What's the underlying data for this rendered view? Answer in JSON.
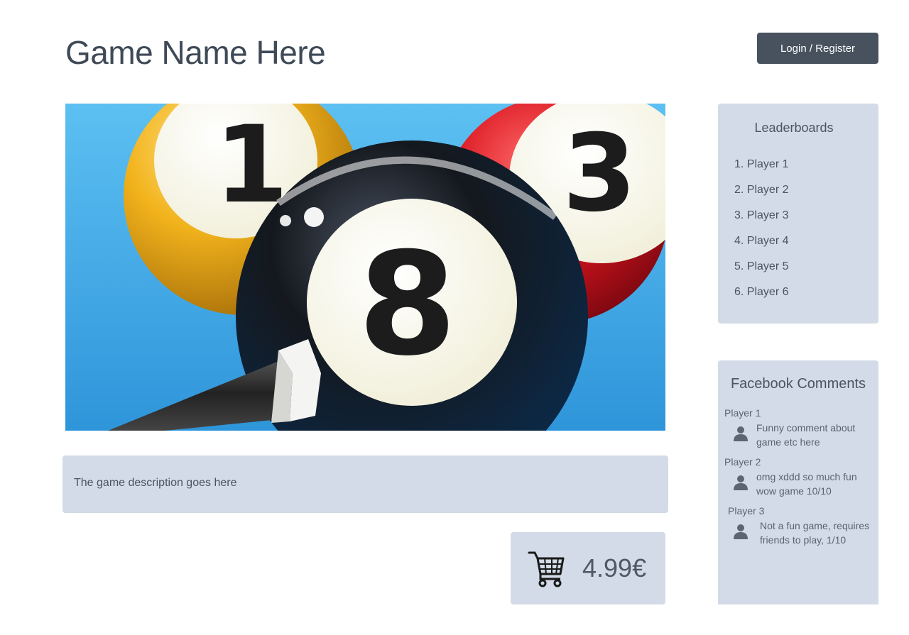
{
  "header": {
    "title": "Game Name Here",
    "login_label": "Login / Register"
  },
  "hero": {
    "ball_numbers": [
      "1",
      "3",
      "8"
    ],
    "colors": {
      "table": "#3aa6e8",
      "ball_1": "#f2b31c",
      "ball_3": "#d9141e",
      "ball_8": "#101418",
      "cue": "#2a2a2a"
    }
  },
  "description": {
    "text": "The game description goes here"
  },
  "purchase": {
    "icon": "shopping-cart-icon",
    "price": "4.99€"
  },
  "leaderboards": {
    "title": "Leaderboards",
    "items": [
      "1. Player 1",
      "2. Player 2",
      "3. Player 3",
      "4. Player 4",
      "5. Player 5",
      "6. Player 6"
    ]
  },
  "facebook_comments": {
    "title": "Facebook Comments",
    "icon": "user-icon",
    "items": [
      {
        "name": "Player 1",
        "text": "Funny comment about game etc here"
      },
      {
        "name": "Player 2",
        "text": "omg xddd so much fun wow game 10/10"
      },
      {
        "name": "Player 3",
        "text": "Not a fun game, requires friends to play, 1/10"
      }
    ]
  },
  "theme": {
    "panel_bg": "#d2dbe7",
    "button_bg": "#47525e",
    "text": "#4a5560"
  }
}
